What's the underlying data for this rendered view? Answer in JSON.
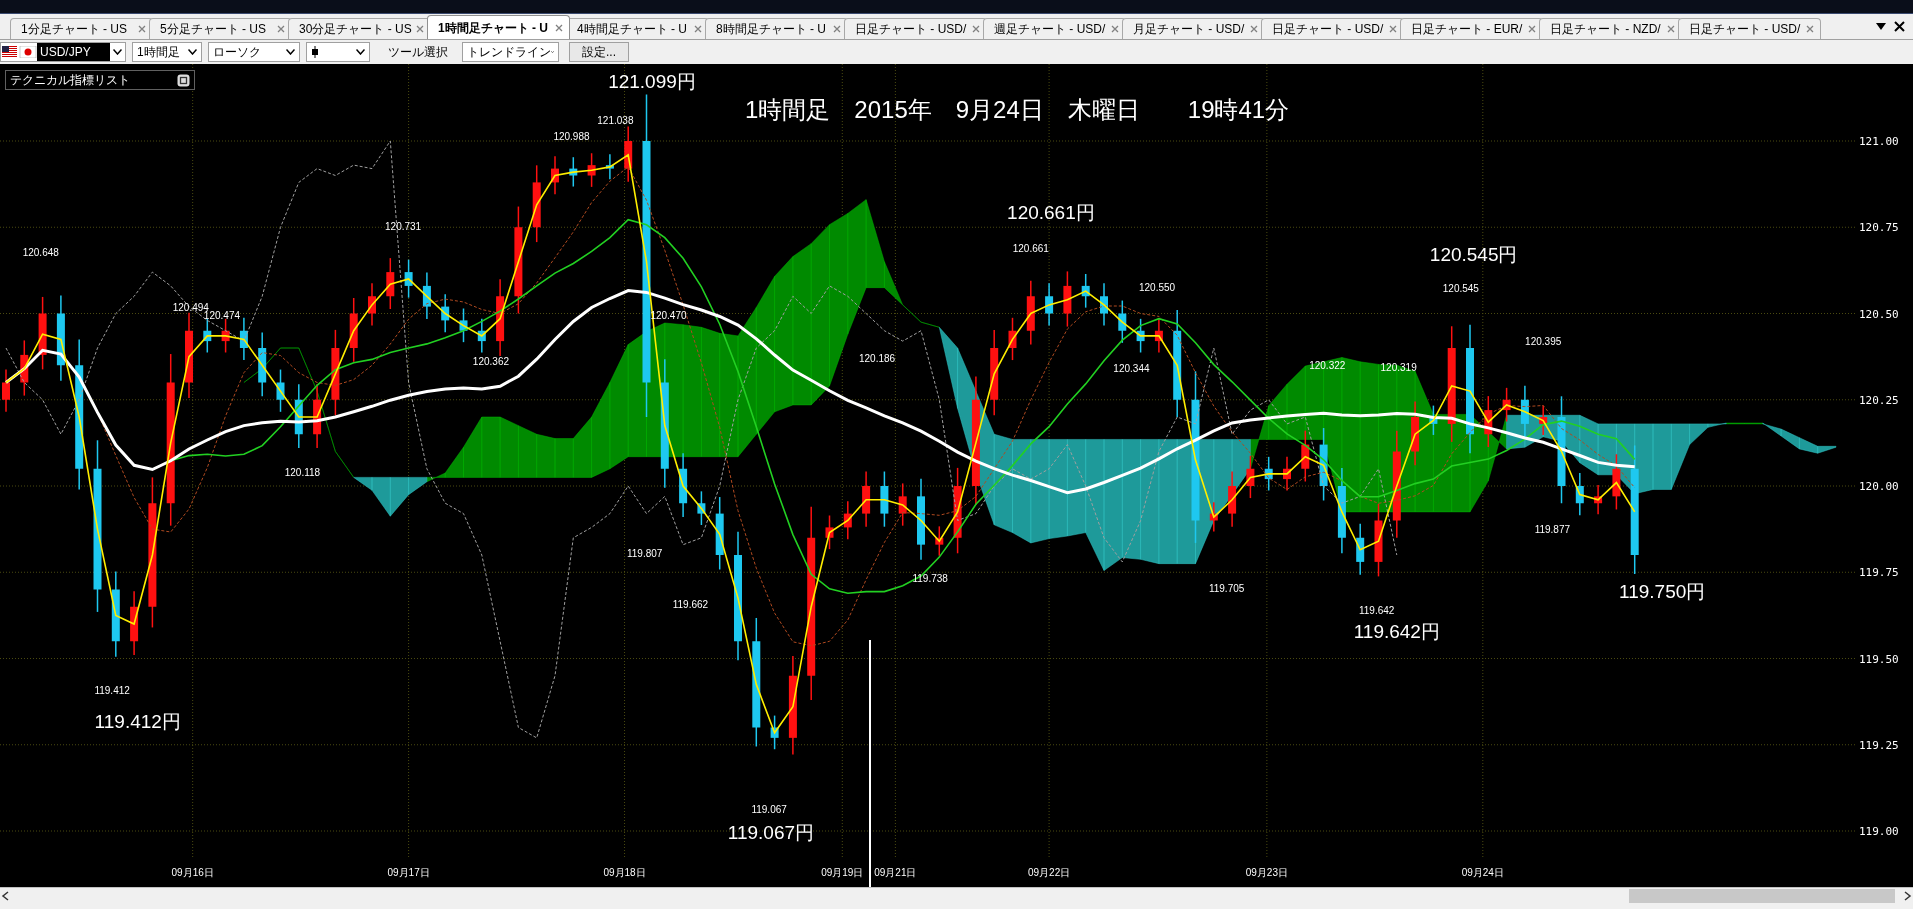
{
  "tabs": [
    {
      "label": "1分足チャート - US",
      "selected": false
    },
    {
      "label": "5分足チャート - US",
      "selected": false
    },
    {
      "label": "30分足チャート - US",
      "selected": false
    },
    {
      "label": "1時間足チャート - U",
      "selected": true
    },
    {
      "label": "4時間足チャート - U",
      "selected": false
    },
    {
      "label": "8時間足チャート - U",
      "selected": false
    },
    {
      "label": "日足チャート - USD/",
      "selected": false
    },
    {
      "label": "週足チャート - USD/",
      "selected": false
    },
    {
      "label": "月足チャート - USD/",
      "selected": false
    },
    {
      "label": "日足チャート - USD/",
      "selected": false
    },
    {
      "label": "日足チャート - EUR/",
      "selected": false
    },
    {
      "label": "日足チャート - NZD/",
      "selected": false
    },
    {
      "label": "日足チャート - USD/",
      "selected": false
    }
  ],
  "toolbar": {
    "pair": "USD/JPY",
    "timeframe": "1時間足",
    "chart_type": "ローソク",
    "tool_label": "ツール選択",
    "tool": "トレンドライン",
    "settings_button": "設定..."
  },
  "indicator_panel": {
    "title": "テクニカル指標リスト"
  },
  "chart": {
    "headline": "1時間足　2015年　9月24日　木曜日　　19時41分",
    "price_axis_labels": [
      "121.00",
      "120.75",
      "120.50",
      "120.25",
      "120.00",
      "119.75",
      "119.50",
      "119.25",
      "119.00"
    ],
    "date_labels": [
      "09月16日",
      "09月17日",
      "09月18日",
      "09月19日",
      "09月21日",
      "09月22日",
      "09月23日",
      "09月24日"
    ],
    "price_labels": [
      {
        "text": "121.099円",
        "kind": "major"
      },
      {
        "text": "120.661円",
        "kind": "major"
      },
      {
        "text": "120.545円",
        "kind": "major"
      },
      {
        "text": "119.412円",
        "kind": "major"
      },
      {
        "text": "119.067円",
        "kind": "major"
      },
      {
        "text": "119.642円",
        "kind": "major"
      },
      {
        "text": "119.750円",
        "kind": "major"
      },
      {
        "text": "120.648",
        "kind": "minor"
      },
      {
        "text": "119.412",
        "kind": "minor"
      },
      {
        "text": "120.494",
        "kind": "minor"
      },
      {
        "text": "120.474",
        "kind": "minor"
      },
      {
        "text": "120.118",
        "kind": "minor"
      },
      {
        "text": "120.731",
        "kind": "minor"
      },
      {
        "text": "120.362",
        "kind": "minor"
      },
      {
        "text": "120.988",
        "kind": "minor"
      },
      {
        "text": "121.038",
        "kind": "minor"
      },
      {
        "text": "119.807",
        "kind": "minor"
      },
      {
        "text": "120.470",
        "kind": "minor"
      },
      {
        "text": "119.662",
        "kind": "minor"
      },
      {
        "text": "119.067",
        "kind": "minor"
      },
      {
        "text": "120.186",
        "kind": "minor"
      },
      {
        "text": "119.738",
        "kind": "minor"
      },
      {
        "text": "120.661",
        "kind": "minor"
      },
      {
        "text": "120.550",
        "kind": "minor"
      },
      {
        "text": "120.344",
        "kind": "minor"
      },
      {
        "text": "119.705",
        "kind": "minor"
      },
      {
        "text": "120.322",
        "kind": "minor"
      },
      {
        "text": "120.319",
        "kind": "minor"
      },
      {
        "text": "119.642",
        "kind": "minor"
      },
      {
        "text": "120.545",
        "kind": "minor"
      },
      {
        "text": "120.395",
        "kind": "minor"
      },
      {
        "text": "119.877",
        "kind": "minor"
      }
    ]
  }
}
